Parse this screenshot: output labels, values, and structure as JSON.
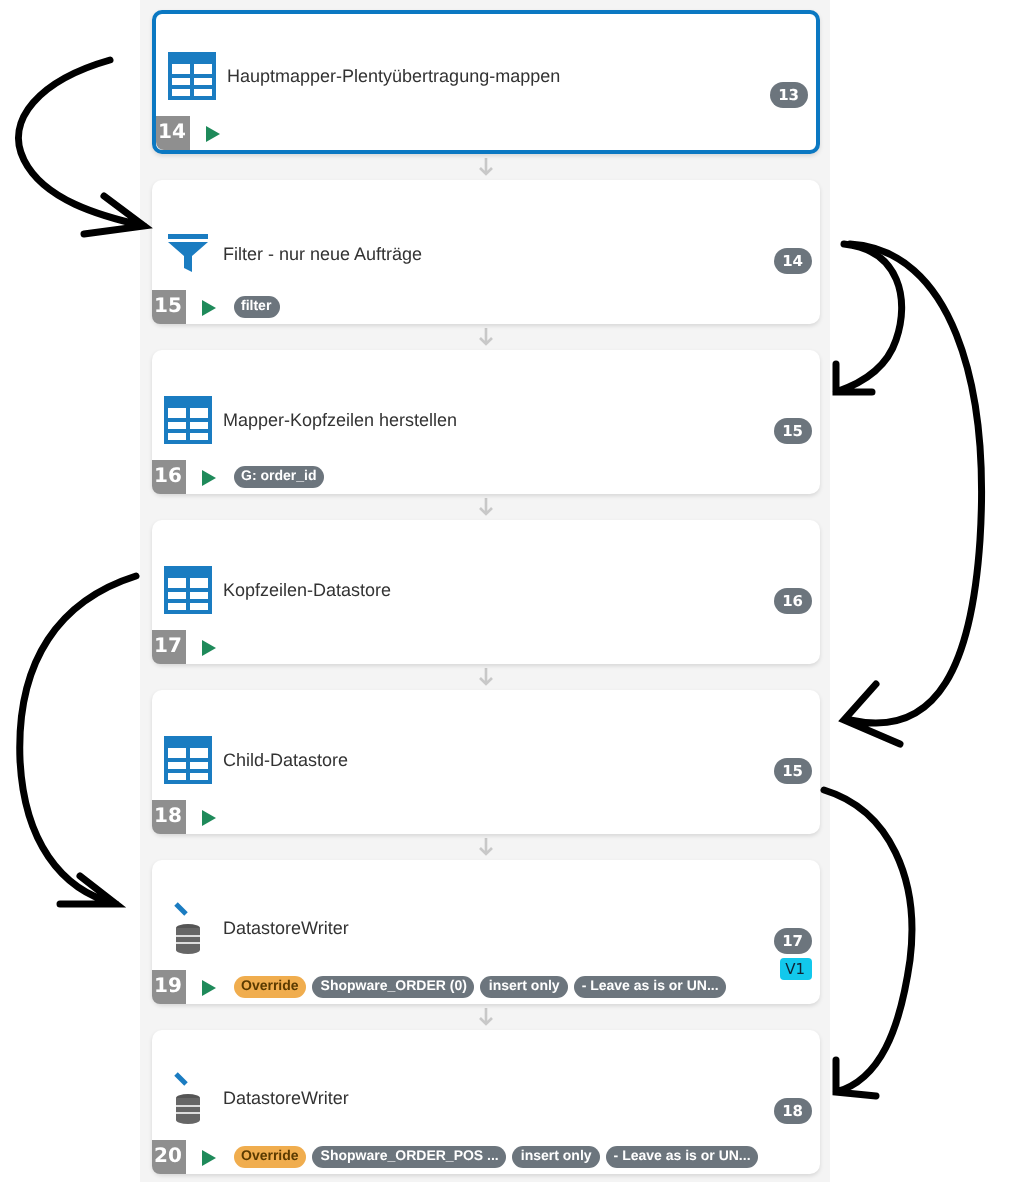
{
  "steps": [
    {
      "title": "Hauptmapper-Plentyübertragung-mappen",
      "kind": "table",
      "selected": true,
      "row": "14",
      "count": "13"
    },
    {
      "title": "Filter - nur neue Aufträge",
      "kind": "filter",
      "selected": false,
      "row": "15",
      "count": "14",
      "tags": [
        {
          "label": "filter",
          "kind": "default"
        }
      ]
    },
    {
      "title": "Mapper-Kopfzeilen herstellen",
      "kind": "table",
      "selected": false,
      "row": "16",
      "count": "15",
      "tags": [
        {
          "label": "G: order_id",
          "kind": "default"
        }
      ]
    },
    {
      "title": "Kopfzeilen-Datastore",
      "kind": "table",
      "selected": false,
      "row": "17",
      "count": "16"
    },
    {
      "title": "Child-Datastore",
      "kind": "table",
      "selected": false,
      "row": "18",
      "count": "15"
    },
    {
      "title": "DatastoreWriter",
      "kind": "writer",
      "selected": false,
      "row": "19",
      "count": "17",
      "version": "V1",
      "tags": [
        {
          "label": "Override",
          "kind": "override"
        },
        {
          "label": "Shopware_ORDER (0)",
          "kind": "default"
        },
        {
          "label": "insert only",
          "kind": "default"
        },
        {
          "label": "- Leave as is or UN...",
          "kind": "default"
        }
      ]
    },
    {
      "title": "DatastoreWriter",
      "kind": "writer",
      "selected": false,
      "row": "20",
      "count": "18",
      "tags": [
        {
          "label": "Override",
          "kind": "override"
        },
        {
          "label": "Shopware_ORDER_POS ...",
          "kind": "default"
        },
        {
          "label": "insert only",
          "kind": "default"
        },
        {
          "label": "- Leave as is or UN...",
          "kind": "default"
        }
      ]
    }
  ]
}
